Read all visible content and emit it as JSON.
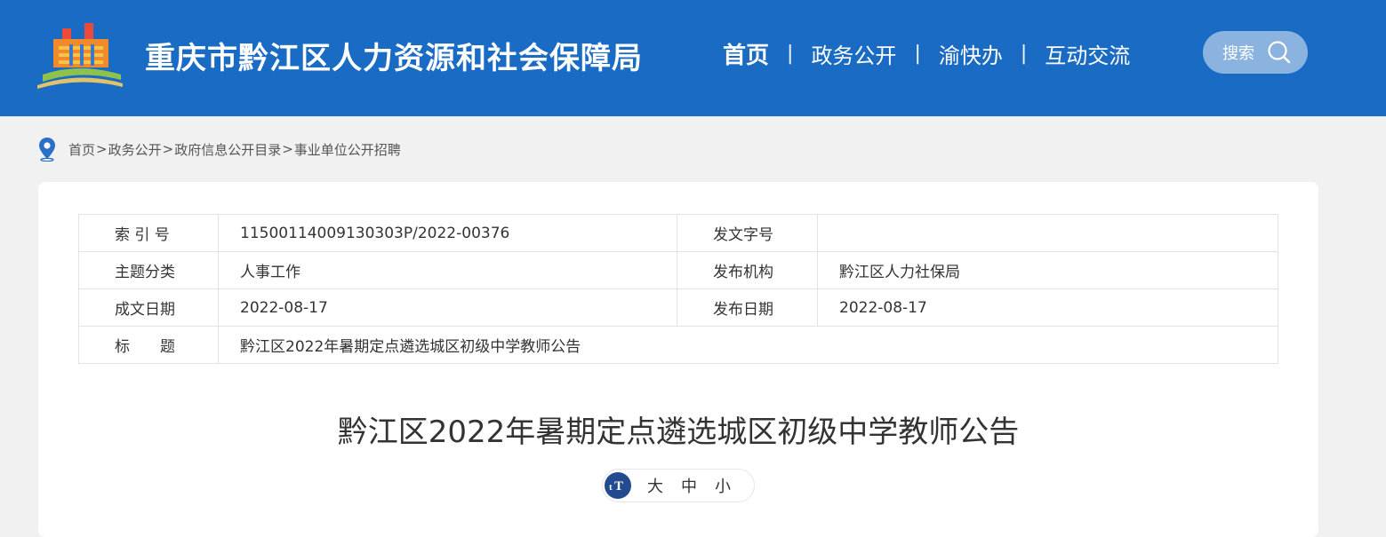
{
  "header": {
    "site_title": "重庆市黔江区人力资源和社会保障局",
    "nav": [
      "首页",
      "政务公开",
      "渝快办",
      "互动交流"
    ],
    "nav_separator": "|",
    "search_label": "搜索",
    "colors": {
      "header_bg": "#1a6bc4",
      "search_bg": "#8bb3e0"
    }
  },
  "breadcrumb": {
    "items": [
      "首页",
      "政务公开",
      "政府信息公开目录",
      "事业单位公开招聘"
    ],
    "separator": ">"
  },
  "meta": {
    "rows": [
      {
        "k1": "索 引 号",
        "v1": "11500114009130303P/2022-00376",
        "k2": "发文字号",
        "v2": ""
      },
      {
        "k1": "主题分类",
        "v1": "人事工作",
        "k2": "发布机构",
        "v2": "黔江区人力社保局"
      },
      {
        "k1": "成文日期",
        "v1": "2022-08-17",
        "k2": "发布日期",
        "v2": "2022-08-17"
      }
    ],
    "title_key": "标　　题",
    "title_value": "黔江区2022年暑期定点遴选城区初级中学教师公告"
  },
  "article": {
    "title": "黔江区2022年暑期定点遴选城区初级中学教师公告",
    "font_sizes": [
      "大",
      "中",
      "小"
    ],
    "font_icon": "tT"
  }
}
